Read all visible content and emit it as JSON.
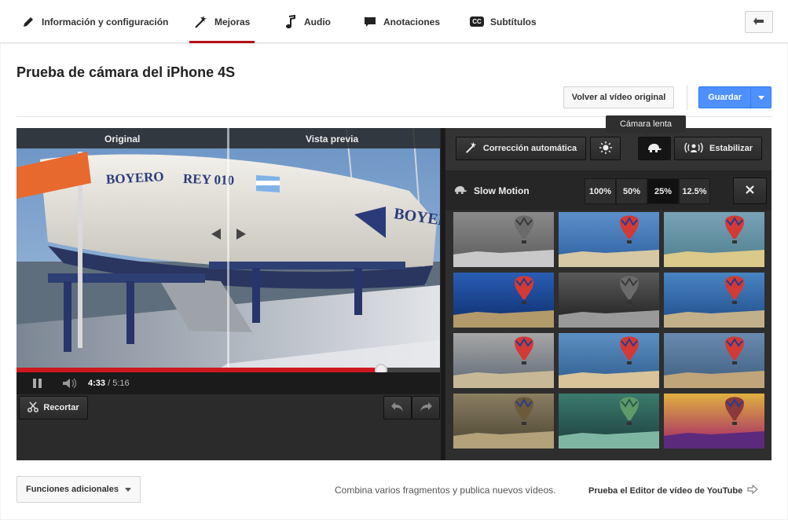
{
  "tabs": [
    {
      "label": "Información y configuración",
      "icon": "pencil-icon"
    },
    {
      "label": "Mejoras",
      "icon": "magic-wand-icon"
    },
    {
      "label": "Audio",
      "icon": "music-note-icon"
    },
    {
      "label": "Anotaciones",
      "icon": "speech-bubble-icon"
    },
    {
      "label": "Subtítulos",
      "icon": "cc-icon"
    }
  ],
  "cc_badge": "CC",
  "page_title": "Prueba de cámara del iPhone 4S",
  "actions": {
    "revert": "Volver al vídeo original",
    "save": "Guardar"
  },
  "video": {
    "label_original": "Original",
    "label_preview": "Vista previa",
    "time_current": "4:33",
    "time_sep": " / ",
    "time_total": "5:16",
    "progress_fraction": 0.86,
    "boat_text_1": "BOYERO",
    "boat_text_2": "REY 010",
    "boat_text_3": "BOYERO"
  },
  "trim_label": "Recortar",
  "tools": {
    "auto_fix": "Corrección automática",
    "stabilize": "Estabilizar",
    "tooltip": "Cámara lenta"
  },
  "slow_motion": {
    "label": "Slow Motion",
    "speeds": [
      "100%",
      "50%",
      "25%",
      "12.5%"
    ],
    "selected_index": 2
  },
  "bottom": {
    "more_functions": "Funciones adicionales",
    "promo_text": "Combina varios fragmentos y publica nuevos vídeos.",
    "promo_link": "Prueba el Editor de vídeo de YouTube"
  },
  "colors": {
    "accent_red": "#cc181e",
    "save_blue": "#4d90fe"
  }
}
